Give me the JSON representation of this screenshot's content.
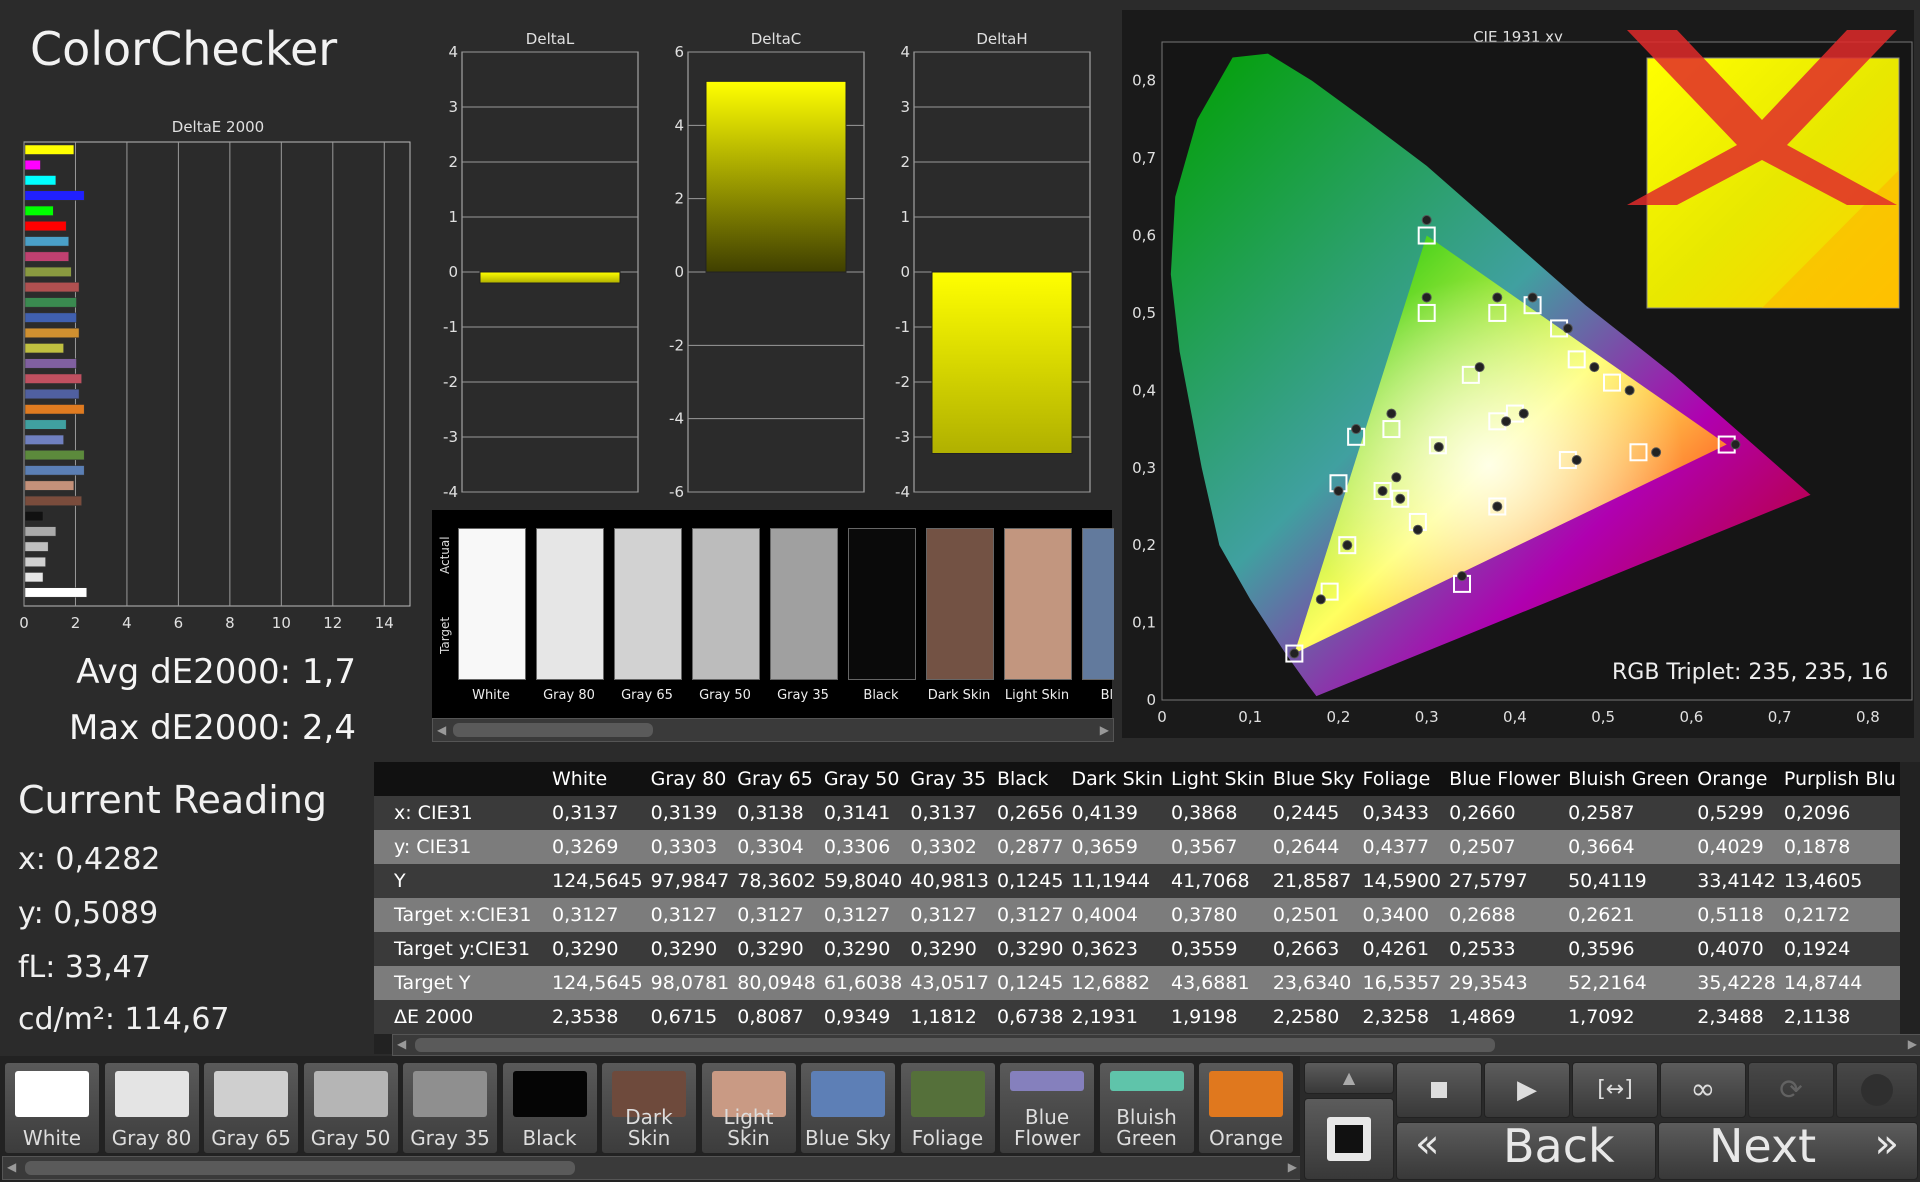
{
  "title": "ColorChecker",
  "chart_data": [
    {
      "type": "bar",
      "title": "DeltaE 2000",
      "orientation": "horizontal",
      "xlim": [
        0,
        15
      ],
      "xticks": [
        "0",
        "2",
        "4",
        "6",
        "8",
        "10",
        "12",
        "14"
      ],
      "bars": [
        {
          "value": 1.9,
          "color": "#ffff00"
        },
        {
          "value": 0.6,
          "color": "#ff00ff"
        },
        {
          "value": 1.2,
          "color": "#00ffff"
        },
        {
          "value": 2.3,
          "color": "#2020ff"
        },
        {
          "value": 1.1,
          "color": "#00ff00"
        },
        {
          "value": 1.6,
          "color": "#ff0000"
        },
        {
          "value": 1.7,
          "color": "#4aa0c8"
        },
        {
          "value": 1.7,
          "color": "#c04070"
        },
        {
          "value": 1.8,
          "color": "#8a9a40"
        },
        {
          "value": 2.1,
          "color": "#b05050"
        },
        {
          "value": 2.0,
          "color": "#3a8a50"
        },
        {
          "value": 2.0,
          "color": "#4060b0"
        },
        {
          "value": 2.1,
          "color": "#d09030"
        },
        {
          "value": 1.5,
          "color": "#c0c040"
        },
        {
          "value": 2.0,
          "color": "#8060a0"
        },
        {
          "value": 2.2,
          "color": "#c05060"
        },
        {
          "value": 2.1,
          "color": "#5060a0"
        },
        {
          "value": 2.3,
          "color": "#e07b20"
        },
        {
          "value": 1.6,
          "color": "#40a0a0"
        },
        {
          "value": 1.5,
          "color": "#7080c0"
        },
        {
          "value": 2.3,
          "color": "#5c8a3c"
        },
        {
          "value": 2.3,
          "color": "#5b7fb5"
        },
        {
          "value": 1.9,
          "color": "#c4917a"
        },
        {
          "value": 2.2,
          "color": "#7a4c3c"
        },
        {
          "value": 0.7,
          "color": "#111111"
        },
        {
          "value": 1.2,
          "color": "#aaaaaa"
        },
        {
          "value": 0.9,
          "color": "#c0c0c0"
        },
        {
          "value": 0.8,
          "color": "#d0d0d0"
        },
        {
          "value": 0.7,
          "color": "#e6e6e6"
        },
        {
          "value": 2.4,
          "color": "#ffffff"
        }
      ]
    },
    {
      "type": "bar",
      "title": "DeltaL",
      "ylim": [
        -4,
        4
      ],
      "yticks": [
        "4",
        "3",
        "2",
        "1",
        "0",
        "-1",
        "-2",
        "-3",
        "-4"
      ],
      "value": -0.2,
      "color": "#ffff00"
    },
    {
      "type": "bar",
      "title": "DeltaC",
      "ylim": [
        -6,
        6
      ],
      "yticks": [
        "6",
        "4",
        "2",
        "0",
        "-2",
        "-4",
        "-6"
      ],
      "value": 5.2,
      "color": "#ffff00"
    },
    {
      "type": "bar",
      "title": "DeltaH",
      "ylim": [
        -4,
        4
      ],
      "yticks": [
        "4",
        "3",
        "2",
        "1",
        "0",
        "-1",
        "-2",
        "-3",
        "-4"
      ],
      "value": -3.3,
      "color": "#ffff00"
    },
    {
      "type": "scatter",
      "title": "CIE 1931 xy",
      "xlim": [
        0,
        0.85
      ],
      "ylim": [
        0,
        0.85
      ],
      "xticks": [
        "0",
        "0,1",
        "0,2",
        "0,3",
        "0,4",
        "0,5",
        "0,6",
        "0,7",
        "0,8"
      ],
      "yticks": [
        "0",
        "0,1",
        "0,2",
        "0,3",
        "0,4",
        "0,5",
        "0,6",
        "0,7",
        "0,8"
      ],
      "target_points": [
        [
          0.3127,
          0.329
        ],
        [
          0.3,
          0.6
        ],
        [
          0.3,
          0.5
        ],
        [
          0.38,
          0.5
        ],
        [
          0.42,
          0.51
        ],
        [
          0.45,
          0.48
        ],
        [
          0.47,
          0.44
        ],
        [
          0.51,
          0.41
        ],
        [
          0.26,
          0.35
        ],
        [
          0.22,
          0.34
        ],
        [
          0.38,
          0.36
        ],
        [
          0.4,
          0.37
        ],
        [
          0.46,
          0.31
        ],
        [
          0.54,
          0.32
        ],
        [
          0.64,
          0.33
        ],
        [
          0.2,
          0.28
        ],
        [
          0.25,
          0.27
        ],
        [
          0.27,
          0.26
        ],
        [
          0.29,
          0.23
        ],
        [
          0.38,
          0.25
        ],
        [
          0.21,
          0.2
        ],
        [
          0.19,
          0.14
        ],
        [
          0.15,
          0.06
        ],
        [
          0.34,
          0.15
        ],
        [
          0.35,
          0.42
        ]
      ],
      "actual_points": [
        [
          0.3137,
          0.3269
        ],
        [
          0.3,
          0.62
        ],
        [
          0.3,
          0.52
        ],
        [
          0.38,
          0.52
        ],
        [
          0.42,
          0.52
        ],
        [
          0.46,
          0.48
        ],
        [
          0.49,
          0.43
        ],
        [
          0.53,
          0.4
        ],
        [
          0.26,
          0.37
        ],
        [
          0.22,
          0.35
        ],
        [
          0.39,
          0.36
        ],
        [
          0.41,
          0.37
        ],
        [
          0.47,
          0.31
        ],
        [
          0.56,
          0.32
        ],
        [
          0.65,
          0.33
        ],
        [
          0.2,
          0.27
        ],
        [
          0.25,
          0.27
        ],
        [
          0.27,
          0.26
        ],
        [
          0.29,
          0.22
        ],
        [
          0.38,
          0.25
        ],
        [
          0.21,
          0.2
        ],
        [
          0.18,
          0.13
        ],
        [
          0.15,
          0.06
        ],
        [
          0.34,
          0.16
        ],
        [
          0.36,
          0.43
        ],
        [
          0.2656,
          0.2877
        ]
      ]
    },
    {
      "type": "table",
      "columns": [
        "White",
        "Gray 80",
        "Gray 65",
        "Gray 50",
        "Gray 35",
        "Black",
        "Dark Skin",
        "Light Skin",
        "Blue Sky",
        "Foliage",
        "Blue Flower",
        "Bluish Green",
        "Orange",
        "Purplish Blu"
      ],
      "rows": [
        {
          "label": "x: CIE31",
          "values": [
            "0,3137",
            "0,3139",
            "0,3138",
            "0,3141",
            "0,3137",
            "0,2656",
            "0,4139",
            "0,3868",
            "0,2445",
            "0,3433",
            "0,2660",
            "0,2587",
            "0,5299",
            "0,2096"
          ]
        },
        {
          "label": "y: CIE31",
          "values": [
            "0,3269",
            "0,3303",
            "0,3304",
            "0,3306",
            "0,3302",
            "0,2877",
            "0,3659",
            "0,3567",
            "0,2644",
            "0,4377",
            "0,2507",
            "0,3664",
            "0,4029",
            "0,1878"
          ]
        },
        {
          "label": "Y",
          "values": [
            "124,5645",
            "97,9847",
            "78,3602",
            "59,8040",
            "40,9813",
            "0,1245",
            "11,1944",
            "41,7068",
            "21,8587",
            "14,5900",
            "27,5797",
            "50,4119",
            "33,4142",
            "13,4605"
          ]
        },
        {
          "label": "Target x:CIE31",
          "values": [
            "0,3127",
            "0,3127",
            "0,3127",
            "0,3127",
            "0,3127",
            "0,3127",
            "0,4004",
            "0,3780",
            "0,2501",
            "0,3400",
            "0,2688",
            "0,2621",
            "0,5118",
            "0,2172"
          ]
        },
        {
          "label": "Target y:CIE31",
          "values": [
            "0,3290",
            "0,3290",
            "0,3290",
            "0,3290",
            "0,3290",
            "0,3290",
            "0,3623",
            "0,3559",
            "0,2663",
            "0,4261",
            "0,2533",
            "0,3596",
            "0,4070",
            "0,1924"
          ]
        },
        {
          "label": "Target Y",
          "values": [
            "124,5645",
            "98,0781",
            "80,0948",
            "61,6038",
            "43,0517",
            "0,1245",
            "12,6882",
            "43,6881",
            "23,6340",
            "16,5357",
            "29,3543",
            "52,2164",
            "35,4228",
            "14,8744"
          ]
        },
        {
          "label": "ΔE 2000",
          "values": [
            "2,3538",
            "0,6715",
            "0,8087",
            "0,9349",
            "1,1812",
            "0,6738",
            "2,1931",
            "1,9198",
            "2,2580",
            "2,3258",
            "1,4869",
            "1,7092",
            "2,3488",
            "2,1138"
          ]
        }
      ]
    }
  ],
  "stats": {
    "avg": "Avg dE2000: 1,7",
    "max": "Max dE2000: 2,4"
  },
  "current_reading": {
    "title": "Current Reading",
    "x": "x: 0,4282",
    "y": "y: 0,5089",
    "fl": "fL: 33,47",
    "cd": "cd/m²: 114,67"
  },
  "rgb_triplet": "RGB Triplet: 235, 235, 16",
  "patch_strip": {
    "actual_label": "Actual",
    "target_label": "Target",
    "patches": [
      {
        "name": "White",
        "color": "#f8f8f8"
      },
      {
        "name": "Gray 80",
        "color": "#e6e6e6"
      },
      {
        "name": "Gray 65",
        "color": "#d2d2d2"
      },
      {
        "name": "Gray 50",
        "color": "#bcbcbc"
      },
      {
        "name": "Gray 35",
        "color": "#a0a0a0"
      },
      {
        "name": "Black",
        "color": "#0a0a0a"
      },
      {
        "name": "Dark Skin",
        "color": "#735244"
      },
      {
        "name": "Light Skin",
        "color": "#c2967f"
      },
      {
        "name": "Blue",
        "color": "#627a9d"
      }
    ]
  },
  "bottom_swatches": [
    {
      "label": "White",
      "color": "#ffffff"
    },
    {
      "label": "Gray 80",
      "color": "#e4e4e4"
    },
    {
      "label": "Gray 65",
      "color": "#cfcfcf"
    },
    {
      "label": "Gray 50",
      "color": "#b5b5b5"
    },
    {
      "label": "Gray 35",
      "color": "#8f8f8f"
    },
    {
      "label": "Black",
      "color": "#050505"
    },
    {
      "label": "Dark Skin",
      "color": "#6e4a3c"
    },
    {
      "label": "Light Skin",
      "color": "#c99a84"
    },
    {
      "label": "Blue Sky",
      "color": "#5d7fb6"
    },
    {
      "label": "Foliage",
      "color": "#55703a"
    },
    {
      "label": "Blue Flower",
      "color": "#8580bd"
    },
    {
      "label": "Bluish Green",
      "color": "#5fc4aa"
    },
    {
      "label": "Orange",
      "color": "#e0781e"
    }
  ],
  "nav": {
    "back": "Back",
    "next": "Next",
    "back_arrows": "«",
    "next_arrows": "»"
  },
  "icons": [
    "up-icon",
    "stop-icon",
    "play-icon",
    "fit-icon",
    "loop-icon",
    "refresh-icon",
    "record-icon"
  ]
}
